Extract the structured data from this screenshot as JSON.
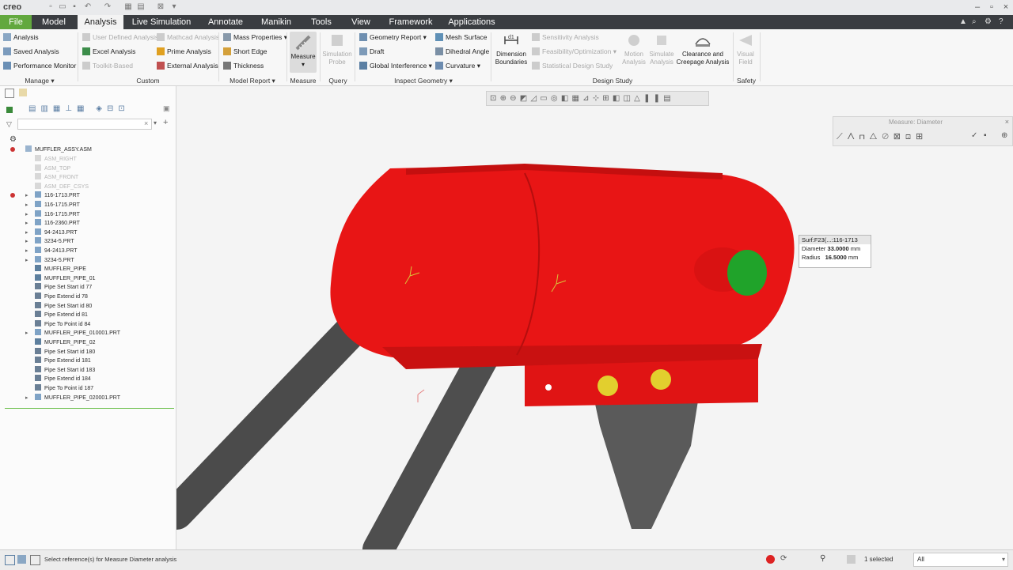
{
  "app": {
    "logo": "creo"
  },
  "tabs": [
    {
      "label": "File"
    },
    {
      "label": "Model"
    },
    {
      "label": "Analysis"
    },
    {
      "label": "Live Simulation"
    },
    {
      "label": "Annotate"
    },
    {
      "label": "Manikin"
    },
    {
      "label": "Tools"
    },
    {
      "label": "View"
    },
    {
      "label": "Framework"
    },
    {
      "label": "Applications"
    }
  ],
  "ribbon": {
    "manage": {
      "items": [
        "Analysis",
        "Saved Analysis",
        "Performance Monitor"
      ],
      "group": "Manage"
    },
    "custom": {
      "items": [
        "User Defined Analysis",
        "Excel Analysis",
        "Toolkit-Based",
        "Mathcad Analysis",
        "Prime Analysis",
        "External Analysis"
      ],
      "group": "Custom"
    },
    "model_report": {
      "items": [
        "Mass Properties",
        "Short Edge",
        "Thickness"
      ],
      "group": "Model Report"
    },
    "measure": {
      "label": "Measure",
      "group": "Measure"
    },
    "query": {
      "label1": "Simulation",
      "label2": "Probe",
      "group": "Query"
    },
    "inspect": {
      "items": [
        "Geometry Report",
        "Draft",
        "Global Interference",
        "Mesh Surface",
        "Dihedral Angle",
        "Curvature"
      ],
      "group": "Inspect Geometry"
    },
    "design_study": {
      "dim_label1": "Dimension",
      "dim_label2": "Boundaries",
      "items": [
        "Sensitivity Analysis",
        "Feasibility/Optimization",
        "Statistical Design Study"
      ],
      "motion1": "Motion",
      "motion2": "Analysis",
      "simulate1": "Simulate",
      "simulate2": "Analysis",
      "clearance1": "Clearance and",
      "clearance2": "Creepage Analysis",
      "group": "Design Study"
    },
    "safety": {
      "label1": "Visual",
      "label2": "Field",
      "group": "Safety"
    }
  },
  "tree": {
    "root": "MUFFLER_ASSY.ASM",
    "items": [
      {
        "label": "ASM_RIGHT",
        "dim": true
      },
      {
        "label": "ASM_TOP",
        "dim": true
      },
      {
        "label": "ASM_FRONT",
        "dim": true
      },
      {
        "label": "ASM_DEF_CSYS",
        "dim": true
      },
      {
        "label": "116-1713.PRT",
        "dim": false
      },
      {
        "label": "116-1715.PRT",
        "dim": false
      },
      {
        "label": "116-1715.PRT",
        "dim": false
      },
      {
        "label": "116-2360.PRT",
        "dim": false
      },
      {
        "label": "94-2413.PRT",
        "dim": false
      },
      {
        "label": "3234-5.PRT",
        "dim": false
      },
      {
        "label": "94-2413.PRT",
        "dim": false
      },
      {
        "label": "3234-5.PRT",
        "dim": false
      },
      {
        "label": "MUFFLER_PIPE",
        "dim": false
      },
      {
        "label": "MUFFLER_PIPE_01",
        "dim": false
      },
      {
        "label": "Pipe Set Start id 77",
        "dim": false
      },
      {
        "label": "Pipe Extend id 78",
        "dim": false
      },
      {
        "label": "Pipe Set Start id 80",
        "dim": false
      },
      {
        "label": "Pipe Extend id 81",
        "dim": false
      },
      {
        "label": "Pipe To Point id 84",
        "dim": false
      },
      {
        "label": "MUFFLER_PIPE_010001.PRT",
        "dim": false
      },
      {
        "label": "MUFFLER_PIPE_02",
        "dim": false
      },
      {
        "label": "Pipe Set Start id 180",
        "dim": false
      },
      {
        "label": "Pipe Extend id 181",
        "dim": false
      },
      {
        "label": "Pipe Set Start id 183",
        "dim": false
      },
      {
        "label": "Pipe Extend id 184",
        "dim": false
      },
      {
        "label": "Pipe To Point id 187",
        "dim": false
      },
      {
        "label": "MUFFLER_PIPE_020001.PRT",
        "dim": false
      }
    ]
  },
  "measure_panel": {
    "title": "Measure: Diameter"
  },
  "callout": {
    "ref": "Surf:F23(...:116-1713",
    "diameter_label": "Diameter",
    "diameter_value": "33.0000",
    "unit": "mm",
    "radius_label": "Radius",
    "radius_value": "16.5000"
  },
  "status": {
    "message": "Select reference(s) for Measure Diameter analysis",
    "selected": "1 selected",
    "filter": "All"
  },
  "colors": {
    "file_tab": "#62a83e",
    "tab_bar": "#3a3d41",
    "muffler": "#e81515",
    "pipe": "#4a4a4a",
    "end_cap": "#22a52a",
    "bolt": "#e0cc30"
  }
}
